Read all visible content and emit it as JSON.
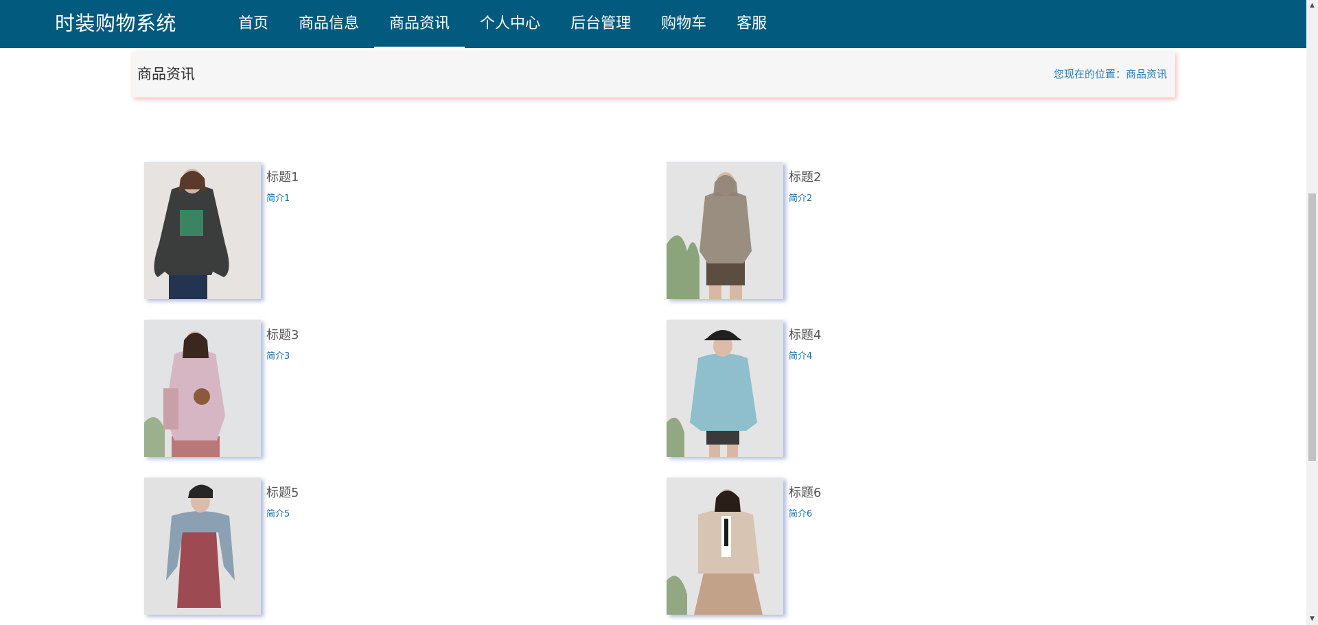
{
  "app": {
    "logo": "时装购物系统"
  },
  "nav": {
    "items": [
      {
        "label": "首页"
      },
      {
        "label": "商品信息"
      },
      {
        "label": "商品资讯"
      },
      {
        "label": "个人中心"
      },
      {
        "label": "后台管理"
      },
      {
        "label": "购物车"
      },
      {
        "label": "客服"
      }
    ],
    "active": "商品资讯"
  },
  "breadcrumb": {
    "title": "商品资讯",
    "location": "您现在的位置：商品资讯"
  },
  "news": [
    {
      "title": "标题1",
      "desc": "简介1",
      "image_icon": "model-dark-sweatshirt-photo"
    },
    {
      "title": "标题2",
      "desc": "简介2",
      "image_icon": "model-beige-hoodie-photo"
    },
    {
      "title": "标题3",
      "desc": "简介3",
      "image_icon": "model-pink-hoodie-photo"
    },
    {
      "title": "标题4",
      "desc": "简介4",
      "image_icon": "model-blue-hoodie-photo"
    },
    {
      "title": "标题5",
      "desc": "简介5",
      "image_icon": "model-denim-jacket-photo"
    },
    {
      "title": "标题6",
      "desc": "简介6",
      "image_icon": "model-fleece-jacket-photo"
    }
  ],
  "colors": {
    "header_bg": "#025a7e",
    "crumb_bg": "#f6f6f6",
    "link": "#2b7bb4"
  }
}
